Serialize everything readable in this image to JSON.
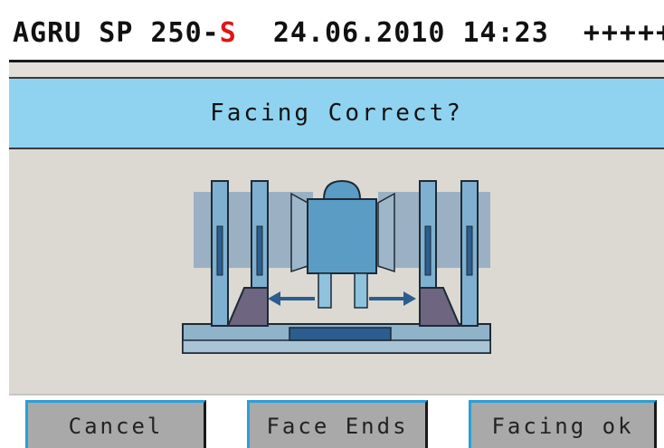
{
  "header": {
    "model": "AGRU SP 250-",
    "model_suffix": "S",
    "date": "24.06.2010",
    "time": "14:23",
    "status": "+++++"
  },
  "dialog": {
    "title": "Facing Correct?"
  },
  "buttons": {
    "cancel": "Cancel",
    "face_ends": "Face Ends",
    "facing_ok": "Facing ok"
  },
  "colors": {
    "title_bar": "#8fd3f0",
    "content_bg": "#dcd9d3",
    "button_bg": "#a9a9a9",
    "button_accent": "#2a9fd6",
    "model_suffix": "#e01515"
  }
}
